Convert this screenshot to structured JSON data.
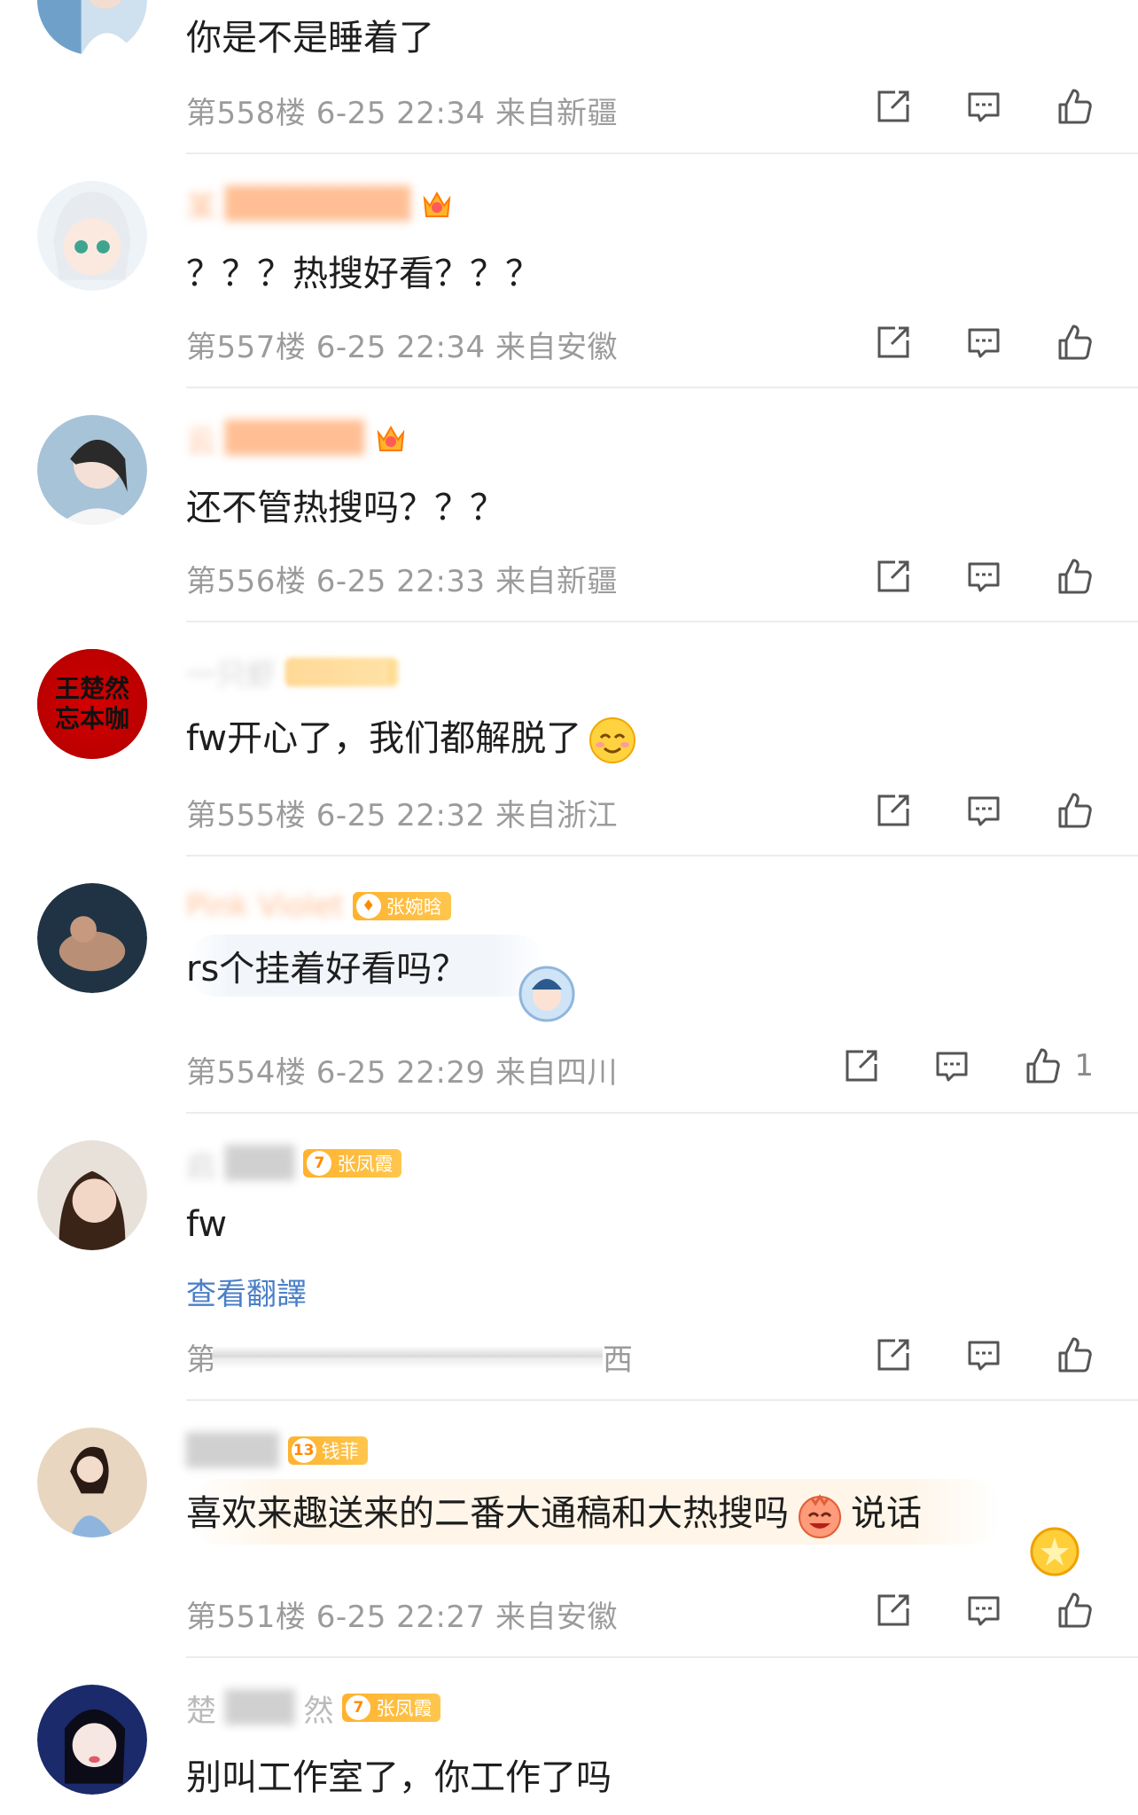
{
  "comments": [
    {
      "id": "c558",
      "text": "你是不是睡着了",
      "meta": "第558楼 6-25 22:34 来自新疆",
      "avatar_color": "#6fa0c9"
    },
    {
      "id": "c557",
      "name": "某",
      "text": "？？？热搜好看？？？",
      "meta": "第557楼 6-25 22:34 来自安徽",
      "avatar_color": "#d8e4f0",
      "crown_level": "6"
    },
    {
      "id": "c556",
      "name": "云",
      "text": "还不管热搜吗？？？",
      "meta": "第556楼 6-25 22:33 来自新疆",
      "avatar_color": "#7fa6c4",
      "crown_level": "2"
    },
    {
      "id": "c555",
      "name": "一只虾",
      "text": "fw开心了，我们都解脱了",
      "meta": "第555楼 6-25 22:32 来自浙江",
      "avatar_label_line1": "王楚然",
      "avatar_label_line2": "忘本咖",
      "avatar_color": "#c00000"
    },
    {
      "id": "c554",
      "name": "Pink Violet",
      "badge": "张婉晗",
      "text": "rs个挂着好看吗？",
      "meta": "第554楼 6-25 22:29 来自四川",
      "like_count": "1",
      "avatar_color": "#2a3a48"
    },
    {
      "id": "c553",
      "name": "启",
      "badge_level": "7",
      "badge": "张凤霞",
      "text": "fw",
      "translate": "查看翻譯",
      "meta_prefix": "第",
      "meta_suffix": "西",
      "avatar_color": "#6b4a3a"
    },
    {
      "id": "c551",
      "name": "",
      "badge_level": "13",
      "badge": "钱菲",
      "text": "喜欢来趣送来的二番大通稿和大热搜吗",
      "text_after": "说话",
      "meta": "第551楼 6-25 22:27 来自安徽",
      "avatar_color": "#c9b6a0"
    },
    {
      "id": "c550",
      "name": "楚",
      "name_tail": "然",
      "badge_level": "7",
      "badge": "张凤霞",
      "text": "别叫工作室了，你工作了吗",
      "avatar_color": "#1b2a6b"
    }
  ],
  "icons": {
    "forward": "forward-icon",
    "reply": "comment-icon",
    "like": "like-icon"
  },
  "colors": {
    "name_orange": "#ff8a3d",
    "badge_gold": "#ffb22e",
    "meta_gray": "#9b9b9b",
    "link_blue": "#4a7fc8"
  }
}
